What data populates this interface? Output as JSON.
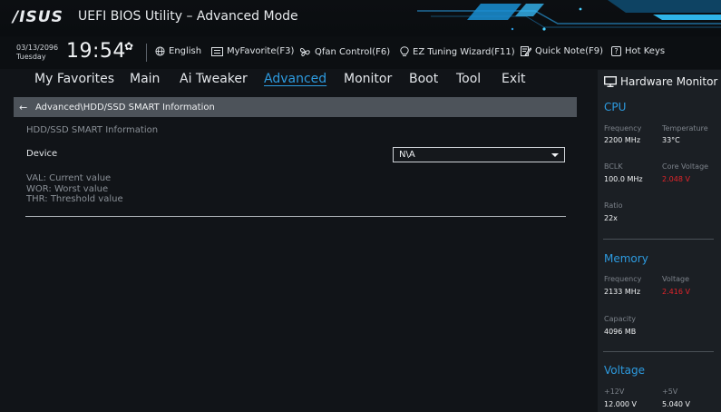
{
  "header": {
    "logo_text": "/ISUS",
    "title": "UEFI BIOS Utility – Advanced Mode"
  },
  "infobar": {
    "date": "03/13/2096",
    "day": "Tuesday",
    "time": "19:54",
    "tools": {
      "language": "English",
      "myfavorite": "MyFavorite(F3)",
      "qfan": "Qfan Control(F6)",
      "ez_tuning": "EZ Tuning Wizard(F11)",
      "quick_note": "Quick Note(F9)",
      "hot_keys": "Hot Keys"
    }
  },
  "menu": {
    "items": [
      "My Favorites",
      "Main",
      "Ai Tweaker",
      "Advanced",
      "Monitor",
      "Boot",
      "Tool",
      "Exit"
    ],
    "active": "Advanced"
  },
  "breadcrumb": "Advanced\\HDD/SSD SMART Information",
  "content": {
    "section_title": "HDD/SSD SMART Information",
    "device_label": "Device",
    "device_value": "N\\A",
    "legend": [
      "VAL:  Current value",
      "WOR: Worst value",
      "THR:  Threshold value"
    ]
  },
  "hardware_monitor": {
    "title": "Hardware Monitor",
    "cpu": {
      "title": "CPU",
      "frequency_label": "Frequency",
      "frequency": "2200 MHz",
      "temperature_label": "Temperature",
      "temperature": "33°C",
      "bclk_label": "BCLK",
      "bclk": "100.0 MHz",
      "core_voltage_label": "Core Voltage",
      "core_voltage": "2.048 V",
      "ratio_label": "Ratio",
      "ratio": "22x"
    },
    "memory": {
      "title": "Memory",
      "frequency_label": "Frequency",
      "frequency": "2133 MHz",
      "voltage_label": "Voltage",
      "voltage": "2.416 V",
      "capacity_label": "Capacity",
      "capacity": "4096 MB"
    },
    "voltage": {
      "title": "Voltage",
      "v12_label": "+12V",
      "v12": "12.000 V",
      "v5_label": "+5V",
      "v5": "5.040 V"
    }
  },
  "colors": {
    "accent": "#2d9be0",
    "warning_value": "#e0242a",
    "breadcrumb_bg": "#4d535a",
    "panel_bg": "#1b1f24"
  }
}
